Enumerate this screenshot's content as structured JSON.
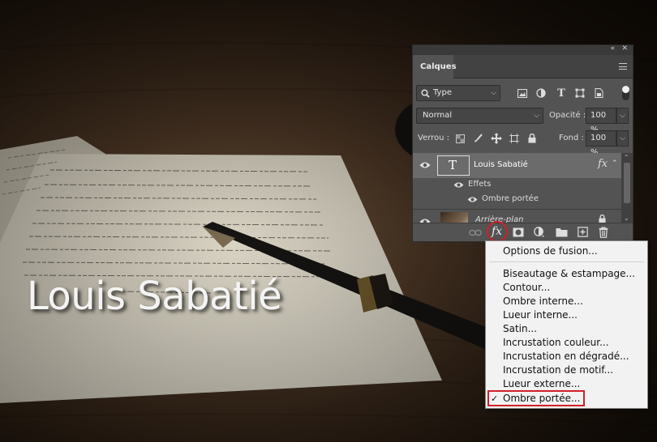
{
  "canvas": {
    "title": "Louis Sabatié"
  },
  "panel": {
    "tab": "Calques",
    "collapse_icon": "double-chevron-icon",
    "close_icon": "close-icon",
    "filter": {
      "value": "Type"
    },
    "blend": {
      "mode": "Normal",
      "opacity_label": "Opacité :",
      "opacity": "100 %"
    },
    "lock": {
      "label": "Verrou :",
      "fill_label": "Fond :",
      "fill": "100 %"
    },
    "layers": [
      {
        "name": "Louis Sabatié",
        "kind": "text",
        "fx": "fx",
        "selected": true
      },
      {
        "name": "Effets",
        "kind": "effects"
      },
      {
        "name": "Ombre portée",
        "kind": "effect"
      },
      {
        "name": "Arrière-plan",
        "kind": "image",
        "locked": true
      }
    ],
    "footer_fx": "fx"
  },
  "fx_menu": {
    "items": [
      "Options de fusion...",
      "Biseautage & estampage...",
      "Contour...",
      "Ombre interne...",
      "Lueur interne...",
      "Satin...",
      "Incrustation couleur...",
      "Incrustation en dégradé...",
      "Incrustation de motif...",
      "Lueur externe...",
      "Ombre portée..."
    ],
    "checked_index": 10,
    "check_mark": "✓"
  },
  "colors": {
    "highlight_red": "#d0202a",
    "panel_bg": "#535353",
    "selected_row": "#6b6b6b"
  }
}
